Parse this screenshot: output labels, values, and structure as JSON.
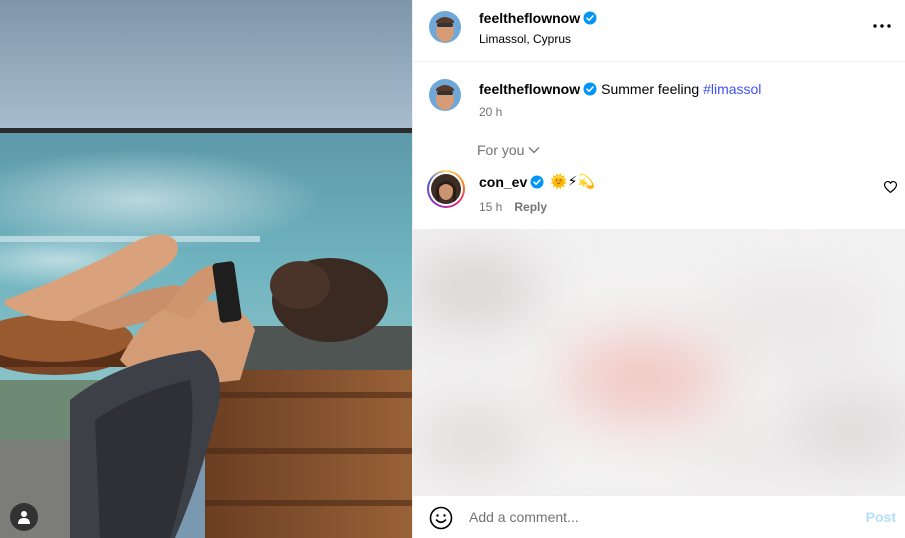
{
  "post": {
    "author": "feeltheflownow",
    "location": "Limassol, Cyprus",
    "verified": true
  },
  "caption": {
    "author": "feeltheflownow",
    "text": "Summer feeling",
    "hashtag": "#limassol",
    "time": "20 h"
  },
  "comments_filter": {
    "label": "For you"
  },
  "comments": [
    {
      "author": "con_ev",
      "text": "🌞⚡💫",
      "time": "15 h",
      "reply_label": "Reply"
    }
  ],
  "comment_bar": {
    "placeholder": "Add a comment...",
    "post_label": "Post"
  },
  "colors": {
    "verified": "#0095f6",
    "hashtag": "#4150f7",
    "post_disabled": "#b2dffc",
    "muted_text": "#737373"
  },
  "icons": {
    "more": "more-horizontal-icon",
    "verified": "verified-badge-icon",
    "chevron": "chevron-down-icon",
    "heart": "heart-icon",
    "emoji": "emoji-icon",
    "user_tag": "user-tag-icon"
  }
}
